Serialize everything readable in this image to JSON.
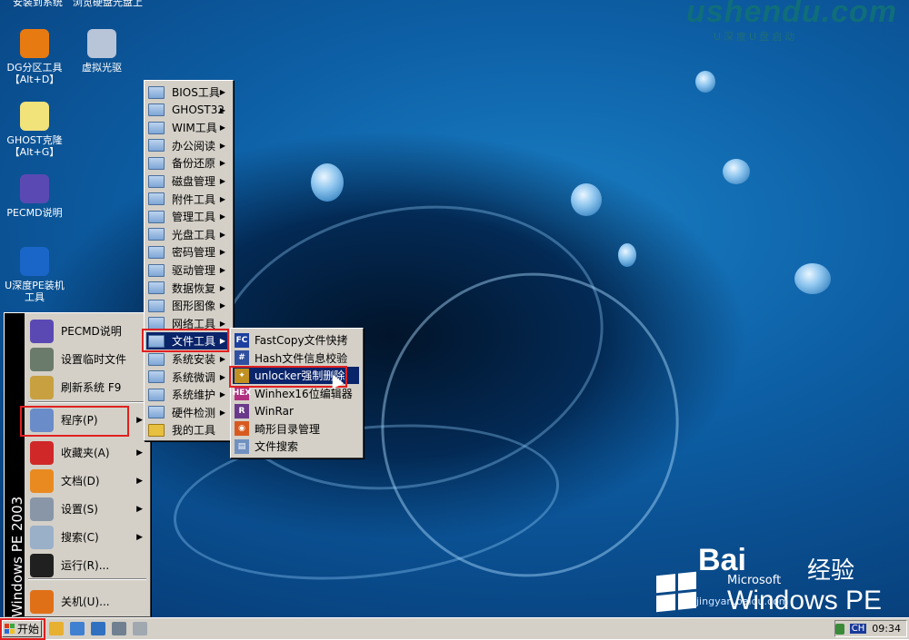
{
  "top_labels": [
    "安装到系统",
    "浏览硬盘光盘上"
  ],
  "logo": {
    "text": "ushendu.com",
    "tagline": "U深度U盘启动"
  },
  "desktop_icons": [
    {
      "label": "DG分区工具\n【Alt+D】",
      "icon": "partition-icon",
      "color": "#e87a12"
    },
    {
      "label": "虚拟光驱",
      "icon": "virtual-drive-icon",
      "color": "#b8c4d8"
    },
    {
      "label": "GHOST克隆\n【Alt+G】",
      "icon": "ghost-icon",
      "color": "#f2e27a"
    },
    {
      "label": "PECMD说明",
      "icon": "help-icon",
      "color": "#5b49b3"
    },
    {
      "label": "U深度PE装机\n工具",
      "icon": "pe-installer-icon",
      "color": "#1a66c8"
    }
  ],
  "start_menu": {
    "band_text": "Windows PE 2003",
    "items": [
      {
        "label": "PECMD说明",
        "icon": "help-icon",
        "color": "#5b49b3",
        "arrow": false
      },
      {
        "label": "设置临时文件",
        "icon": "memory-chip-icon",
        "color": "#6b7b6b",
        "arrow": false
      },
      {
        "label": "刷新系统 F9",
        "icon": "refresh-brush-icon",
        "color": "#c8a040",
        "arrow": false
      },
      {
        "label": "程序(P)",
        "icon": "programs-icon",
        "color": "#6a8cc8",
        "arrow": true
      },
      {
        "label": "收藏夹(A)",
        "icon": "favorites-heart-icon",
        "color": "#d02828",
        "arrow": true
      },
      {
        "label": "文档(D)",
        "icon": "documents-icon",
        "color": "#e88a20",
        "arrow": true
      },
      {
        "label": "设置(S)",
        "icon": "settings-tools-icon",
        "color": "#8896a8",
        "arrow": true
      },
      {
        "label": "搜索(C)",
        "icon": "search-icon",
        "color": "#9ab0c8",
        "arrow": true
      },
      {
        "label": "运行(R)...",
        "icon": "run-terminal-icon",
        "color": "#202020",
        "arrow": false
      },
      {
        "label": "关机(U)...",
        "icon": "shutdown-icon",
        "color": "#e07018",
        "arrow": false
      }
    ]
  },
  "programs_menu": {
    "items": [
      {
        "label": "BIOS工具",
        "arrow": true
      },
      {
        "label": "GHOST32",
        "arrow": true
      },
      {
        "label": "WIM工具",
        "arrow": true
      },
      {
        "label": "办公阅读",
        "arrow": true
      },
      {
        "label": "备份还原",
        "arrow": true
      },
      {
        "label": "磁盘管理",
        "arrow": true
      },
      {
        "label": "附件工具",
        "arrow": true
      },
      {
        "label": "管理工具",
        "arrow": true
      },
      {
        "label": "光盘工具",
        "arrow": true
      },
      {
        "label": "密码管理",
        "arrow": true
      },
      {
        "label": "驱动管理",
        "arrow": true
      },
      {
        "label": "数据恢复",
        "arrow": true
      },
      {
        "label": "图形图像",
        "arrow": true
      },
      {
        "label": "网络工具",
        "arrow": true
      },
      {
        "label": "文件工具",
        "arrow": true,
        "selected": true
      },
      {
        "label": "系统安装",
        "arrow": true
      },
      {
        "label": "系统微调",
        "arrow": true
      },
      {
        "label": "系统维护",
        "arrow": true
      },
      {
        "label": "硬件检测",
        "arrow": true
      },
      {
        "label": "我的工具",
        "arrow": false
      }
    ]
  },
  "file_tools_menu": {
    "items": [
      {
        "label": "FastCopy文件快拷",
        "icon": "fastcopy-icon",
        "color": "#1c3fa0",
        "glyph": "FC"
      },
      {
        "label": "Hash文件信息校验",
        "icon": "hash-key-icon",
        "color": "#3050a0",
        "glyph": "#"
      },
      {
        "label": "unlocker强制删除",
        "icon": "unlocker-wand-icon",
        "color": "#c09020",
        "glyph": "✦",
        "selected": true
      },
      {
        "label": "Winhex16位编辑器",
        "icon": "winhex-icon",
        "color": "#b03080",
        "glyph": "HEX"
      },
      {
        "label": "WinRar",
        "icon": "winrar-icon",
        "color": "#6a3a8a",
        "glyph": "R"
      },
      {
        "label": "畸形目录管理",
        "icon": "folder-manager-icon",
        "color": "#d85a20",
        "glyph": "◉"
      },
      {
        "label": "文件搜索",
        "icon": "file-search-icon",
        "color": "#7090c0",
        "glyph": "▤"
      }
    ]
  },
  "taskbar": {
    "start_label": "开始",
    "quicklaunch": [
      {
        "icon": "folder-icon",
        "color": "#e8b030"
      },
      {
        "icon": "desktop-icon",
        "color": "#4080d0"
      },
      {
        "icon": "explorer-icon",
        "color": "#3070c0"
      },
      {
        "icon": "tools-icon",
        "color": "#708090"
      },
      {
        "icon": "drive-icon",
        "color": "#a0a8b0"
      }
    ],
    "tray": {
      "lang": "CH",
      "time": "09:34"
    }
  },
  "watermark": {
    "baidu": "Bai",
    "jingyan": "经验",
    "site": "jingyan.baidu.com",
    "ms": "Microsoft",
    "winpe": "Windows PE"
  },
  "colors": {
    "selection": "#0a246a",
    "highlight_box": "#e02020",
    "menu_face": "#d4d0c8"
  }
}
